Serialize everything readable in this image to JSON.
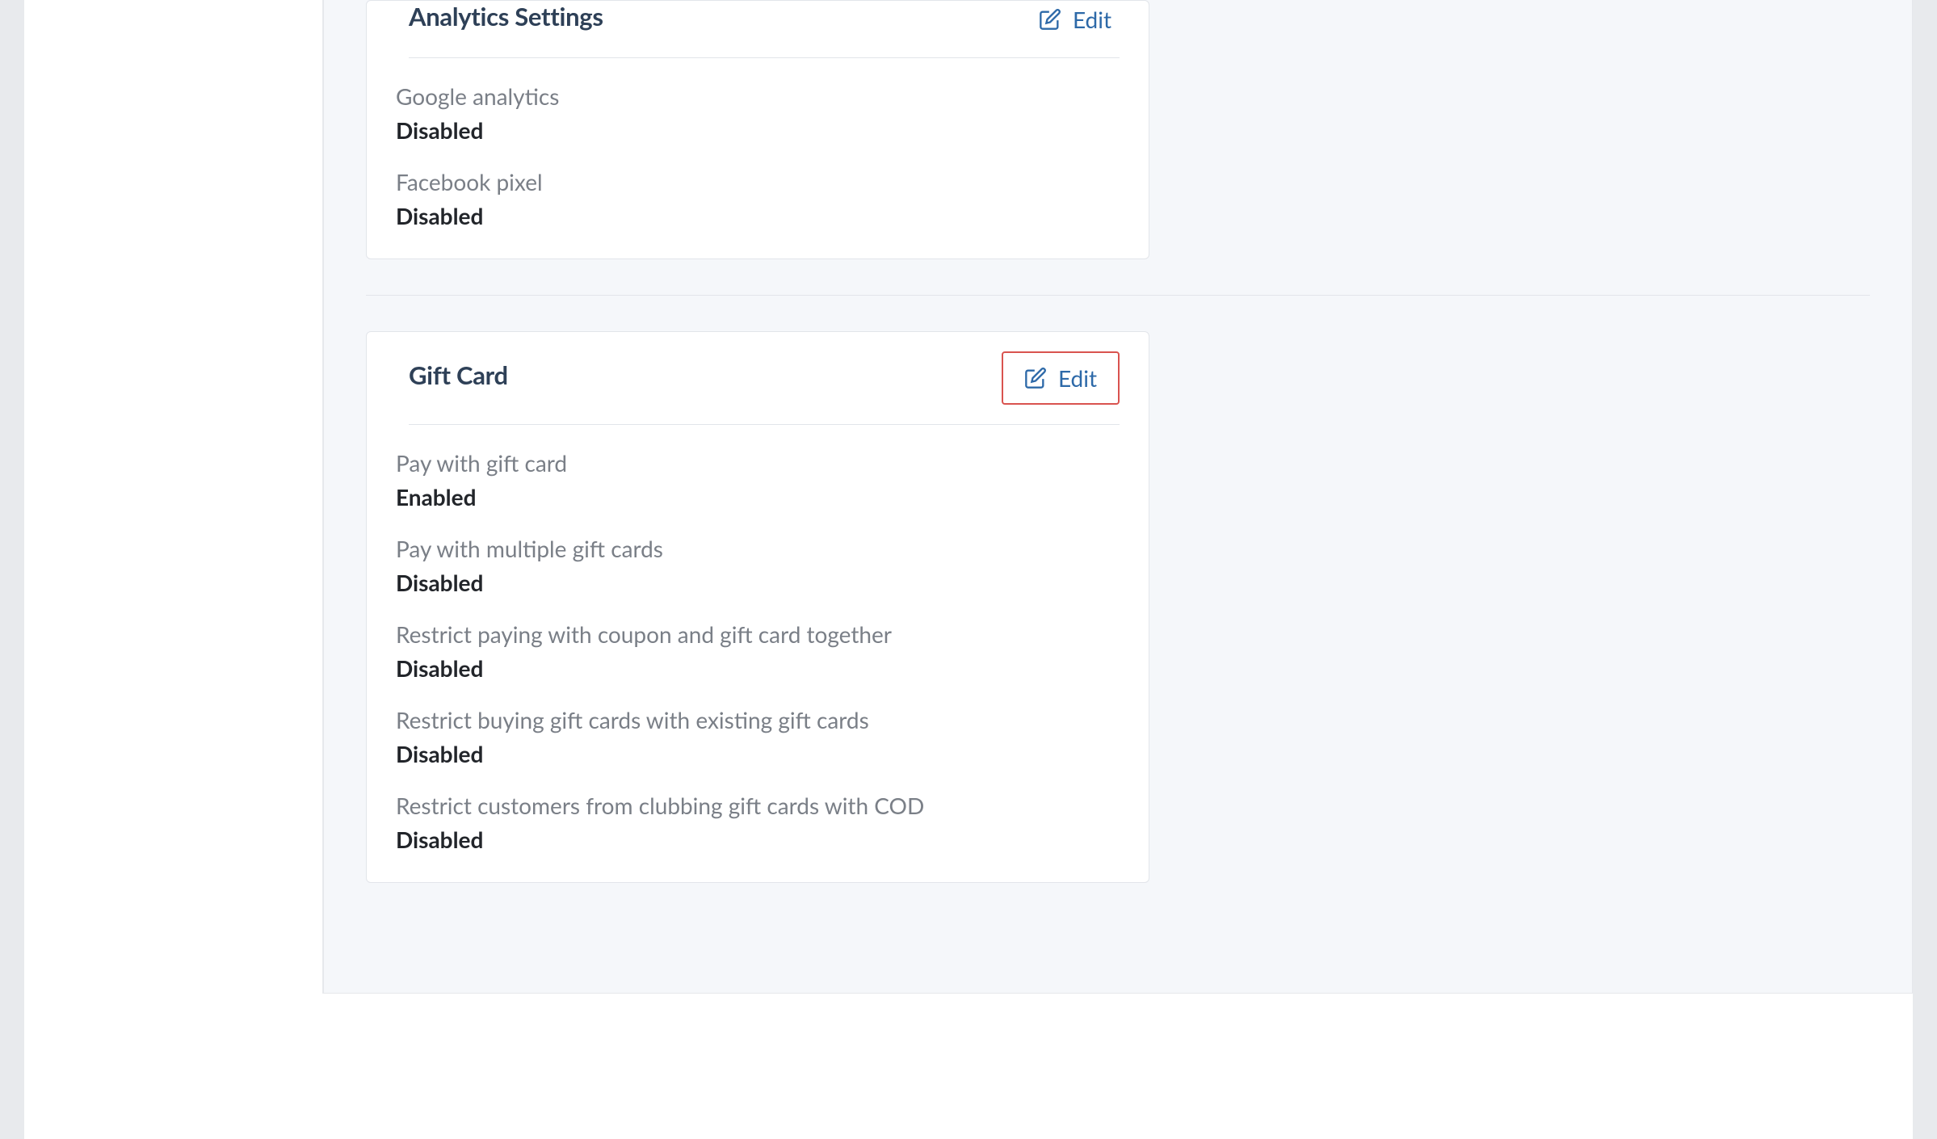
{
  "edit_label": "Edit",
  "analytics_card": {
    "title": "Analytics Settings",
    "rows": [
      {
        "label": "Google analytics",
        "value": "Disabled"
      },
      {
        "label": "Facebook pixel",
        "value": "Disabled"
      }
    ]
  },
  "giftcard_card": {
    "title": "Gift Card",
    "rows": [
      {
        "label": "Pay with gift card",
        "value": "Enabled"
      },
      {
        "label": "Pay with multiple gift cards",
        "value": "Disabled"
      },
      {
        "label": "Restrict paying with coupon and gift card together",
        "value": "Disabled"
      },
      {
        "label": "Restrict buying gift cards with existing gift cards",
        "value": "Disabled"
      },
      {
        "label": "Restrict customers from clubbing gift cards with COD",
        "value": "Disabled"
      }
    ]
  }
}
